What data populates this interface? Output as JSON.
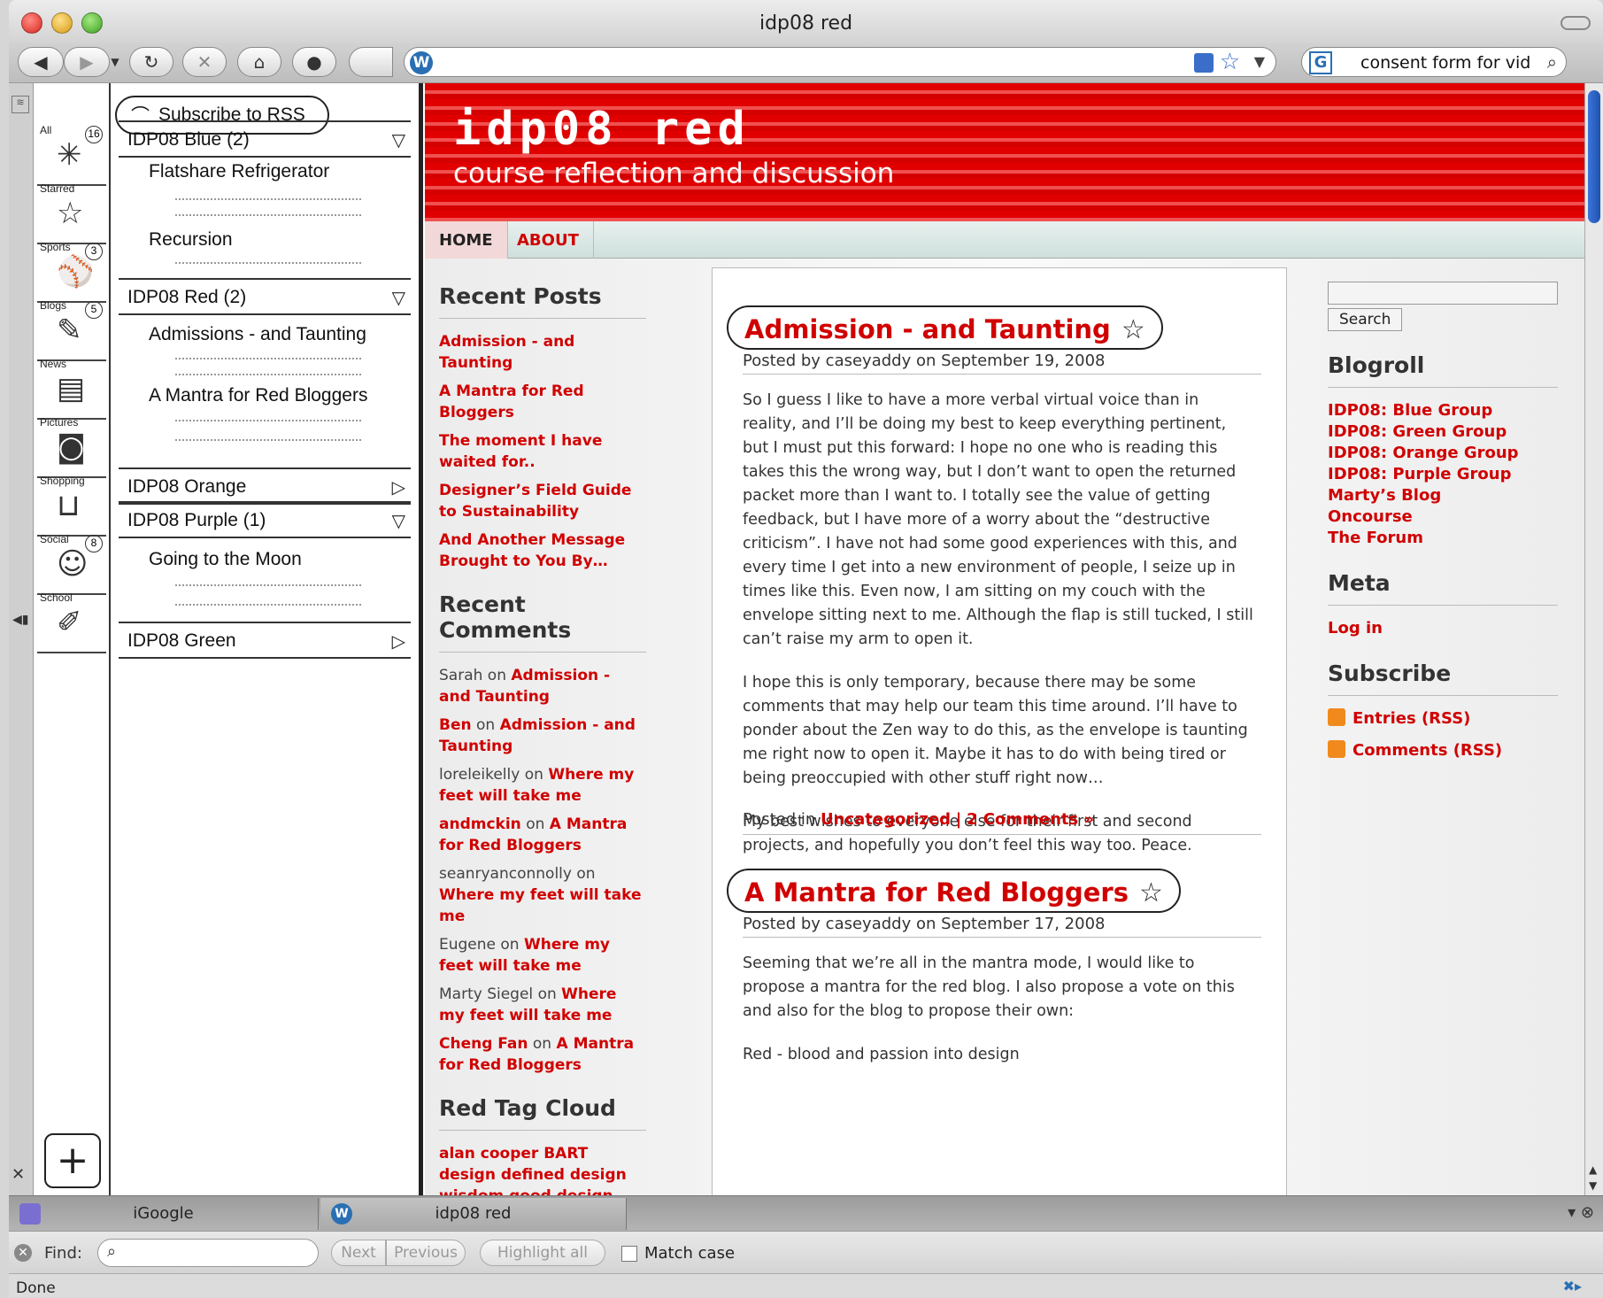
{
  "window": {
    "title": "idp08 red"
  },
  "toolbar": {
    "search_value": "consent form for vid",
    "search_engine_glyph": "G",
    "site_glyph": "W"
  },
  "sidebar": {
    "subscribe_label": "Subscribe to RSS",
    "categories": [
      {
        "label": "All",
        "count": "16",
        "icon": "asterisk-icon"
      },
      {
        "label": "Starred",
        "count": "",
        "icon": "star-icon"
      },
      {
        "label": "Sports",
        "count": "3",
        "icon": "sports-icon"
      },
      {
        "label": "Blogs",
        "count": "5",
        "icon": "blog-icon"
      },
      {
        "label": "News",
        "count": "",
        "icon": "news-icon"
      },
      {
        "label": "Pictures",
        "count": "",
        "icon": "camera-icon"
      },
      {
        "label": "Shopping",
        "count": "",
        "icon": "shopping-bag-icon"
      },
      {
        "label": "Social",
        "count": "8",
        "icon": "people-icon"
      },
      {
        "label": "School",
        "count": "",
        "icon": "school-icon"
      }
    ],
    "feeds": {
      "blue": "IDP08 Blue (2)",
      "blue_items": [
        "Flatshare Refrigerator",
        "Recursion"
      ],
      "red": "IDP08 Red (2)",
      "red_items": [
        "Admissions - and Taunting",
        "A Mantra for Red Bloggers"
      ],
      "orange": "IDP08 Orange",
      "purple": "IDP08 Purple (1)",
      "purple_items": [
        "Going to the Moon"
      ],
      "green": "IDP08 Green"
    }
  },
  "blog": {
    "title": "idp08 red",
    "tagline": "course reflection and discussion",
    "nav": [
      "HOME",
      "ABOUT"
    ],
    "recent_posts_title": "Recent Posts",
    "recent_posts": [
      "Admission - and Taunting",
      "A Mantra for Red Bloggers",
      "The moment I have waited for..",
      "Designer’s Field Guide to Sustainability",
      "And Another Message Brought to You By…"
    ],
    "recent_comments_title": "Recent Comments",
    "recent_comments": [
      {
        "author": "Sarah",
        "on": "on",
        "post": "Admission - and Taunting",
        "author_link": false
      },
      {
        "author": "Ben",
        "on": "on",
        "post": "Admission - and Taunting",
        "author_link": true
      },
      {
        "author": "loreleikelly",
        "on": "on",
        "post": "Where my feet will take me",
        "author_link": false
      },
      {
        "author": "andmckin",
        "on": "on",
        "post": "A Mantra for Red Bloggers",
        "author_link": true
      },
      {
        "author": "seanryanconnolly",
        "on": "on",
        "post": "Where my feet will take me",
        "author_link": false
      },
      {
        "author": "Eugene",
        "on": "on",
        "post": "Where my feet will take me",
        "author_link": false
      },
      {
        "author": "Marty Siegel",
        "on": "on",
        "post": "Where my feet will take me",
        "author_link": false
      },
      {
        "author": "Cheng Fan",
        "on": "on",
        "post": "A Mantra for Red Bloggers",
        "author_link": true
      }
    ],
    "tag_cloud_title": "Red Tag Cloud",
    "tag_cloud": "alan cooper BART design defined design wisdom good design hello world innovation interaction",
    "post1": {
      "title": "Admission - and Taunting",
      "meta": "Posted by caseyaddy on September 19, 2008",
      "paragraphs": [
        "So I guess I like to have a more verbal virtual voice than in reality, and I’ll be doing my best to keep everything pertinent, but I must put this forward: I hope no one who is reading this takes this the wrong way, but I don’t want to open the returned packet more than I want to. I totally see the value of getting feedback, but I have more of a worry about the “destructive criticism”. I have not had some good experiences with this, and every time I get into a new environment of people, I seize up in times like this. Even now, I am sitting on my couch with the envelope sitting next to me. Although the flap is still tucked, I still can’t raise my arm to open it.",
        "I hope this is only temporary, because there may be some comments that may help our team this time around. I’ll have to ponder about the Zen way to do this, as the envelope is taunting me right now to open it. Maybe it has to do with being tired or being preoccupied with other stuff right now…",
        "My best wishes to everyone else for their first and second projects, and hopefully you don’t feel this way too. Peace."
      ],
      "posted_in": "Posted in",
      "category": "Uncategorized",
      "sep": "|",
      "comments": "2 Comments »"
    },
    "post2": {
      "title": "A Mantra for Red Bloggers",
      "meta": "Posted by caseyaddy on September 17, 2008",
      "paragraphs": [
        "Seeming that we’re all in the mantra mode, I would like to propose a mantra for the red blog. I also propose a vote on this and also for the blog to propose their own:",
        "Red - blood and passion into design"
      ]
    },
    "search_button": "Search",
    "blogroll_title": "Blogroll",
    "blogroll": [
      "IDP08: Blue Group",
      "IDP08: Green Group",
      "IDP08: Orange Group",
      "IDP08: Purple Group",
      "Marty’s Blog",
      "Oncourse",
      "The Forum"
    ],
    "meta_title": "Meta",
    "meta_login": "Log in",
    "subscribe_title": "Subscribe",
    "subscribe": [
      "Entries (RSS)",
      "Comments (RSS)"
    ]
  },
  "tabs": [
    "iGoogle",
    "idp08 red"
  ],
  "findbar": {
    "label": "Find:",
    "next": "Next",
    "previous": "Previous",
    "highlight": "Highlight all",
    "match_case": "Match case"
  },
  "status": "Done"
}
